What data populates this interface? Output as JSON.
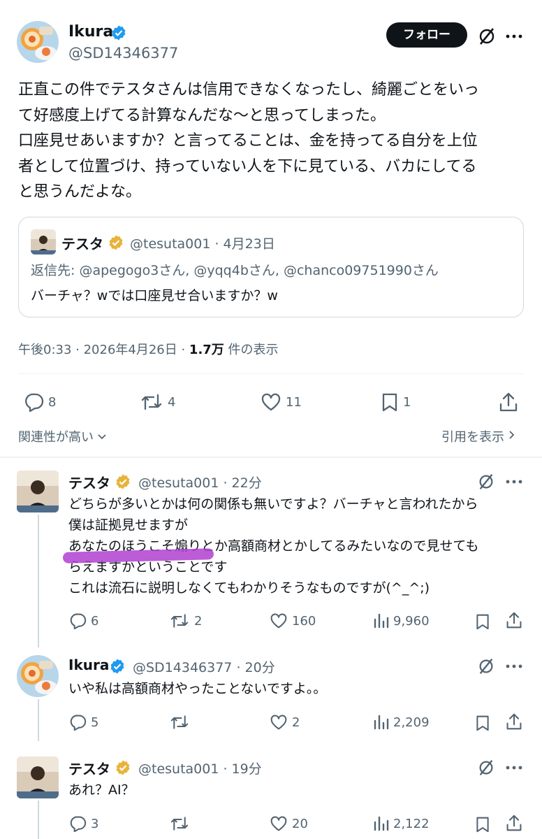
{
  "main_tweet": {
    "author_name": "Ikura",
    "author_handle": "@SD14346377",
    "follow_label": "フォロー",
    "text_lines": [
      "正直この件でテスタさんは信用できなくなったし、綺麗ごとをいっ",
      "て好感度上げてる計算なんだな〜と思ってしまった。",
      "口座見せあいますか？と言ってることは、金を持ってる自分を上位",
      "者として位置づけ、持っていない人を下に見ている、バカにしてる",
      "と思うんだよな。"
    ],
    "quote": {
      "name": "テスタ",
      "handle_date": "@tesuta001 · 4月23日",
      "reply_to": "返信先: @apegogo3さん, @yqq4bさん, @chanco09751990さん",
      "text": "バーチャ？wでは口座見せ合いますか？w"
    },
    "meta_time": "午後0:33 · 2026年4月26日 · ",
    "meta_views": "1.7万",
    "meta_views_label": " 件の表示",
    "stats": {
      "replies": "8",
      "retweets": "4",
      "likes": "11",
      "bookmarks": "1"
    },
    "relevance_label": "関連性が高い",
    "quotes_link": "引用を表示"
  },
  "replies": [
    {
      "name": "テスタ",
      "handle_time": "@tesuta001 · 22分",
      "lines": [
        "どちらが多いとかは何の関係も無いですよ？バーチャと言われたから",
        "僕は証拠見せますが",
        "あなたのほうこそ煽りとか高額商材とかしてるみたいなので見せても",
        "らえますかということです",
        "これは流石に説明しなくてもわかりそうなものですが(^_^;)"
      ],
      "replies": "6",
      "retweets": "2",
      "likes": "160",
      "views": "9,960"
    },
    {
      "name": "Ikura",
      "handle_time": "@SD14346377 · 20分",
      "lines": [
        "いや私は高額商材やったことないですよ。。"
      ],
      "replies": "5",
      "retweets": "",
      "likes": "2",
      "views": "2,209"
    },
    {
      "name": "テスタ",
      "handle_time": "@tesuta001 · 19分",
      "lines": [
        "あれ？AI？"
      ],
      "replies": "3",
      "retweets": "",
      "likes": "20",
      "views": "2,122"
    }
  ],
  "colors": {
    "verified_blue": "#1d9bf0",
    "verified_gold": "#e8b339",
    "highlight": "#b03fd0",
    "text": "#0f1419",
    "muted": "#536471"
  },
  "icons": [
    "verified-badge-icon",
    "grok-icon",
    "more-icon",
    "reply-icon",
    "retweet-icon",
    "like-icon",
    "bookmark-icon",
    "share-icon",
    "views-icon",
    "chevron-down-icon",
    "chevron-right-icon"
  ]
}
